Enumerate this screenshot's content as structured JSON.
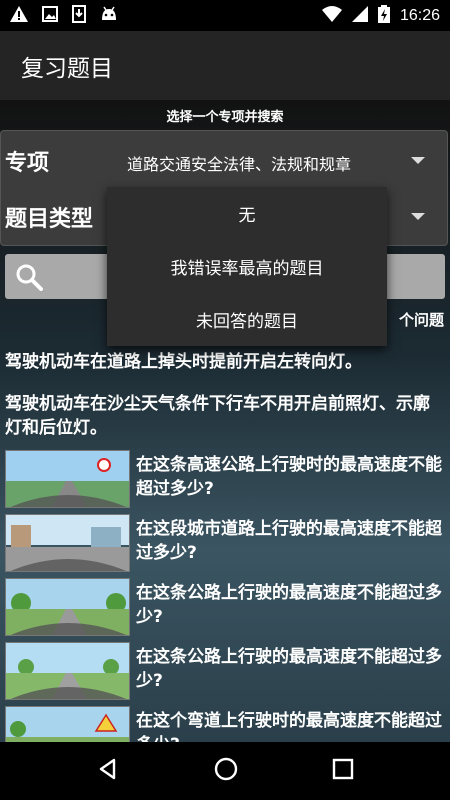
{
  "status_bar": {
    "time": "16:26",
    "left_icons": [
      "warning-icon",
      "image-icon",
      "download-icon",
      "android-icon"
    ],
    "right_icons": [
      "wifi-icon",
      "signal-icon",
      "battery-charging-icon"
    ]
  },
  "app_bar": {
    "title": "复习题目"
  },
  "filter": {
    "hint": "选择一个专项并搜索",
    "category_label": "专项",
    "category_value": "道路交通安全法律、法规和规章",
    "type_label": "题目类型"
  },
  "dropdown": {
    "options": [
      "无",
      "我错误率最高的题目",
      "未回答的题目"
    ]
  },
  "search": {
    "count_text": "个问题"
  },
  "questions": [
    "驾驶机动车在道路上掉头时提前开启左转向灯。",
    "驾驶机动车在沙尘天气条件下行车不用开启前照灯、示廓灯和后位灯。",
    "在这条高速公路上行驶时的最高速度不能超过多少?",
    "在这段城市道路上行驶的最高速度不能超过多少?",
    "在这条公路上行驶的最高速度不能超过多少?",
    "在这条公路上行驶的最高速度不能超过多少?",
    "在这个弯道上行驶时的最高速度不能超过多少?"
  ],
  "colors": {
    "app_bar": "#242424",
    "panel": "#3c3c3c",
    "search_box": "#a9a9a9",
    "dropdown": "#2d2d2d"
  },
  "nav_bar": {
    "icons": [
      "back-icon",
      "home-icon",
      "recents-icon"
    ]
  }
}
